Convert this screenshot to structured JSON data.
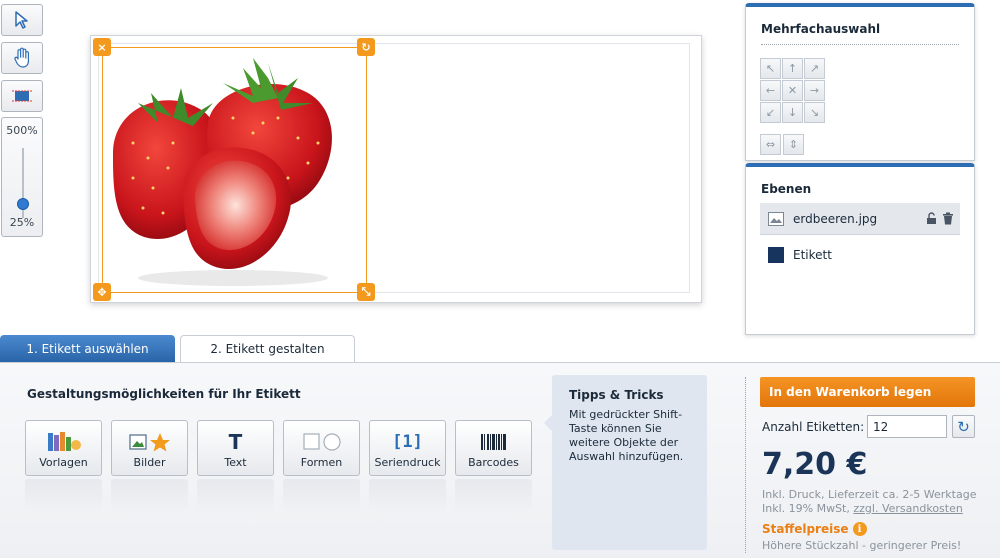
{
  "toolbar": {
    "zoom_max": "500%",
    "zoom_min": "25%",
    "zoom_level": 0.2
  },
  "canvas": {
    "image_file": "erdbeeren.jpg"
  },
  "multi_select": {
    "title": "Mehrfachauswahl"
  },
  "layers": {
    "title": "Ebenen",
    "items": [
      {
        "name": "erdbeeren.jpg"
      },
      {
        "name": "Etikett"
      }
    ]
  },
  "tabs": [
    {
      "label": "1. Etikett auswählen",
      "active": true
    },
    {
      "label": "2. Etikett gestalten",
      "active": false
    }
  ],
  "design": {
    "heading": "Gestaltungsmöglichkeiten für Ihr Etikett",
    "tools": [
      {
        "label": "Vorlagen",
        "icon": "books-icon"
      },
      {
        "label": "Bilder",
        "icon": "image-star-icon"
      },
      {
        "label": "Text",
        "icon": "text-t-icon"
      },
      {
        "label": "Formen",
        "icon": "shapes-icon"
      },
      {
        "label": "Seriendruck",
        "icon": "serial-number-icon"
      },
      {
        "label": "Barcodes",
        "icon": "barcode-icon"
      }
    ]
  },
  "tips": {
    "title": "Tipps & Tricks",
    "text": "Mit gedrückter Shift-Taste können Sie weitere Objekte der Auswahl hinzufügen."
  },
  "order": {
    "cart_button": "In den Warenkorb legen",
    "quantity_label": "Anzahl Etiketten:",
    "quantity_value": "12",
    "price": "7,20 €",
    "price_info_line1": "Inkl. Druck, Lieferzeit ca. 2-5 Werktage",
    "price_info_line2_prefix": "Inkl. 19% MwSt,",
    "shipping_link": "zzgl. Versandkosten",
    "tier_title": "Staffelpreise",
    "tier_subtitle": "Höhere Stückzahl - geringerer Preis!"
  },
  "colors": {
    "accent_blue": "#2d6db3",
    "accent_orange": "#f39a1e",
    "label_color": "#17345f"
  }
}
